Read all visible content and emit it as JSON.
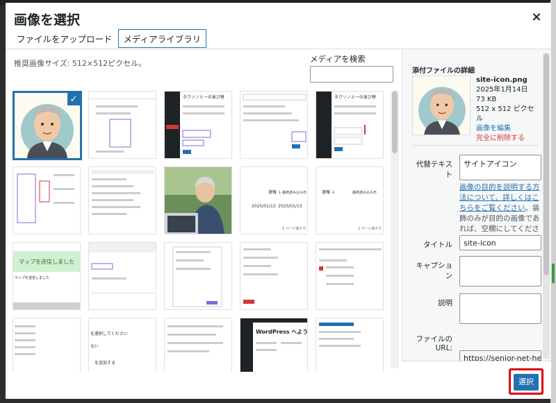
{
  "modal": {
    "title": "画像を選択",
    "close_symbol": "×"
  },
  "tabs": [
    {
      "label": "ファイルをアップロード",
      "active": false
    },
    {
      "label": "メディアライブラリ",
      "active": true
    }
  ],
  "library": {
    "size_note": "推奨画像サイズ: 512×512ピクセル。",
    "search_label": "メディアを検索",
    "search_value": "",
    "check_symbol": "✓"
  },
  "details": {
    "heading": "添付ファイルの詳細",
    "filename": "site-icon.png",
    "date": "2025年1月14日",
    "filesize": "73 KB",
    "dimensions": "512 x 512 ピクセル",
    "edit_link": "画像を編集",
    "delete_link": "完全に削除する",
    "alt_label": "代替テキスト",
    "alt_value": "サイトアイコン",
    "alt_help_link": "画像の目的を説明する方法について、詳しくはこちらをご覧ください",
    "alt_help_text": "。装飾のみが目的の画像であれば、空欄にしてください。",
    "title_label": "タイトル",
    "title_value": "site-icon",
    "caption_label": "キャプション",
    "caption_value": "",
    "description_label": "説明",
    "description_value": "",
    "url_label_line1": "ファイルの",
    "url_label_line2": "URL:",
    "url_value": "https://senior-net-help.cc"
  },
  "footer": {
    "select_label": "選択"
  },
  "thumbnail_texts": {
    "t4_header": "タクソノミーの並び替",
    "t5_header": "タクソノミーの並び替",
    "t9_label": "速報 ↓",
    "t9_col": "最終読み込み日",
    "t9_date1": "2025/01/13",
    "t9_date2": "2025/01/13",
    "t9_foot": "1 ページあたり",
    "t10_label": "速報 ↓",
    "t10_col": "最終読み込み日",
    "t10_foot": "1 ページあたり",
    "t11_banner": "マップを送信しました",
    "t11_body": "マップを送信しました",
    "t20_title": "WordPress へようこそ!",
    "t16_a": "を選択してください",
    "t16_b": "ない",
    "t16_c": "を追加する"
  }
}
